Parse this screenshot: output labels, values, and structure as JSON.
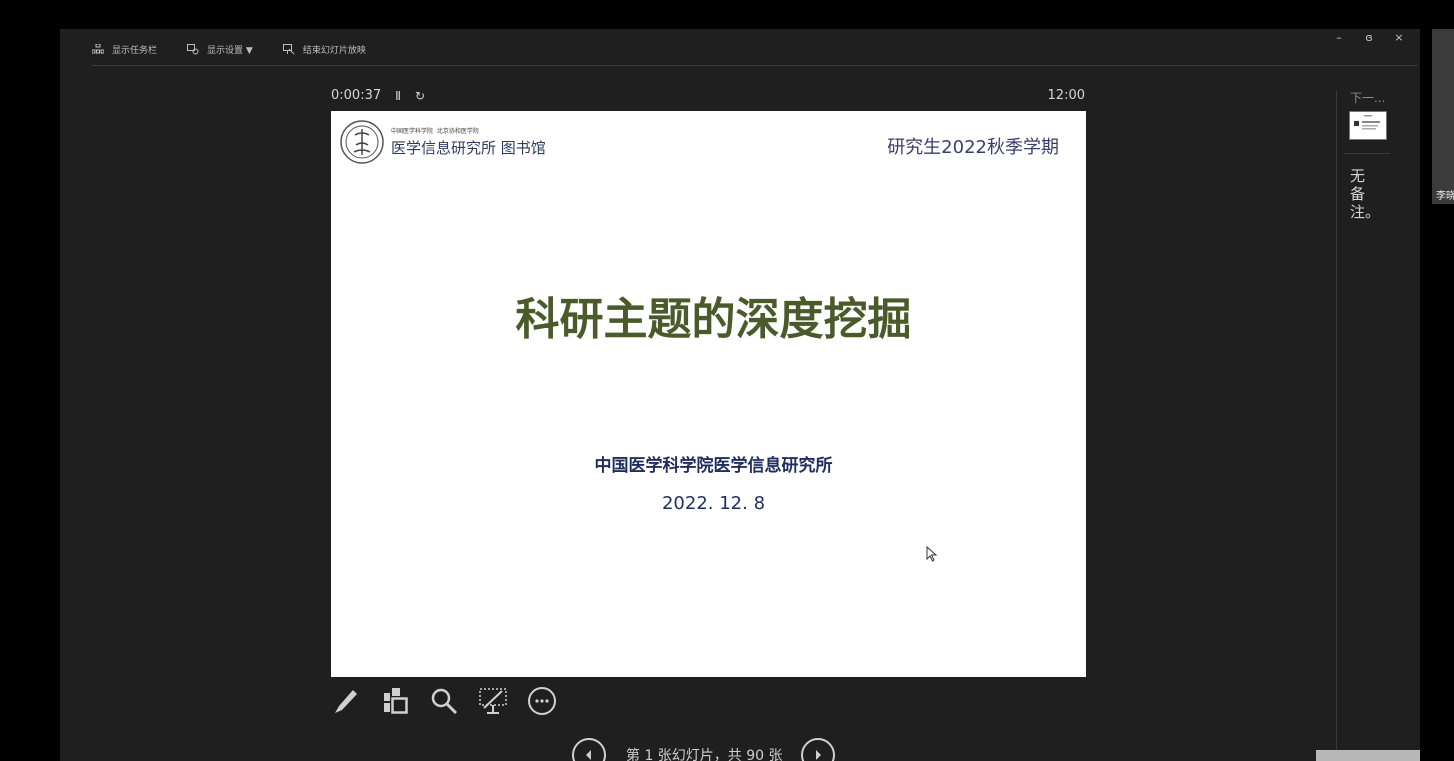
{
  "toolbar": {
    "items": [
      {
        "label": "显示任务栏",
        "icon": "taskbar-icon"
      },
      {
        "label": "显示设置 ▼",
        "icon": "display-settings-icon"
      },
      {
        "label": "结束幻灯片放映",
        "icon": "end-slideshow-icon"
      }
    ]
  },
  "window_controls": {
    "minimize": "–",
    "restore": "ɞ",
    "close": "×"
  },
  "timer": {
    "elapsed": "0:00:37",
    "pause": "Ⅱ",
    "reset": "↻",
    "clock": "12:00"
  },
  "slide": {
    "logo_small_left": "中国医学科学院",
    "logo_small_right": "北京协和医学院",
    "logo_big": "医学信息研究所 图书馆",
    "semester": "研究生2022秋季学期",
    "title": "科研主题的深度挖掘",
    "institute": "中国医学科学院医学信息研究所",
    "date": "2022. 12. 8"
  },
  "tools": [
    "pen-tool",
    "slide-overview",
    "zoom",
    "screen-black",
    "more-options"
  ],
  "navigation": {
    "text": "第 1 张幻灯片，共 90 张",
    "current": 1,
    "total": 90
  },
  "right_panel": {
    "next_label": "下一...",
    "notes": "无备注。"
  },
  "participant": {
    "name": "李晓"
  },
  "colors": {
    "title": "#4a5a2a",
    "navy": "#1f2e5e",
    "background": "#1f1f1f"
  }
}
